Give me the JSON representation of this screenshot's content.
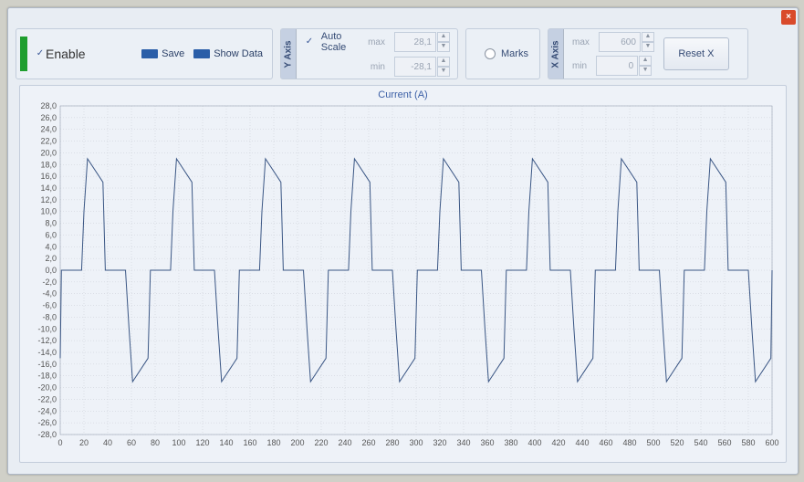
{
  "window": {
    "close_symbol": "×"
  },
  "toolbar": {
    "enable": {
      "checked": true,
      "label": "Enable"
    },
    "save_label": "Save",
    "showdata_label": "Show Data"
  },
  "yaxis": {
    "tab": "Y Axis",
    "autoscale": {
      "checked": true,
      "label": "Auto Scale"
    },
    "max": "28,1",
    "min": "-28,1"
  },
  "marks": {
    "label": "Marks"
  },
  "xaxis": {
    "tab": "X Axis",
    "max_label": "max",
    "max": "600",
    "min_label": "min",
    "min": "0",
    "reset_label": "Reset X"
  },
  "chart_data": {
    "type": "line",
    "title": "Current (A)",
    "xlabel": "",
    "ylabel": "",
    "xlim": [
      0,
      600
    ],
    "ylim": [
      -28,
      28
    ],
    "x_ticks": [
      0,
      20,
      40,
      60,
      80,
      100,
      120,
      140,
      160,
      180,
      200,
      220,
      240,
      260,
      280,
      300,
      320,
      340,
      360,
      380,
      400,
      420,
      440,
      460,
      480,
      500,
      520,
      540,
      560,
      580,
      600
    ],
    "y_ticks": [
      28,
      26,
      24,
      22,
      20,
      18,
      16,
      14,
      12,
      10,
      8,
      6,
      4,
      2,
      0,
      -2,
      -4,
      -6,
      -8,
      -10,
      -12,
      -14,
      -16,
      -18,
      -20,
      -22,
      -24,
      -26,
      -28
    ],
    "y_tick_labels": [
      "28,0",
      "26,0",
      "24,0",
      "22,0",
      "20,0",
      "18,0",
      "16,0",
      "14,0",
      "12,0",
      "10,0",
      "8,0",
      "6,0",
      "4,0",
      "2,0",
      "0,0",
      "-2,0",
      "-4,0",
      "-6,0",
      "-8,0",
      "-10,0",
      "-12,0",
      "-14,0",
      "-16,0",
      "-18,0",
      "-20,0",
      "-22,0",
      "-24,0",
      "-26,0",
      "-28,0"
    ],
    "series": [
      {
        "name": "Current",
        "period": 75,
        "phase": 18,
        "segments": [
          {
            "dx": 0,
            "y": 0
          },
          {
            "dx": 2,
            "y": 10
          },
          {
            "dx": 5,
            "y": 19
          },
          {
            "dx": 18,
            "y": 15
          },
          {
            "dx": 20,
            "y": 0
          },
          {
            "dx": 37,
            "y": 0
          },
          {
            "dx": 40,
            "y": -10
          },
          {
            "dx": 43,
            "y": -19
          },
          {
            "dx": 56,
            "y": -15
          },
          {
            "dx": 58,
            "y": 0
          },
          {
            "dx": 75,
            "y": 0
          }
        ]
      }
    ]
  }
}
